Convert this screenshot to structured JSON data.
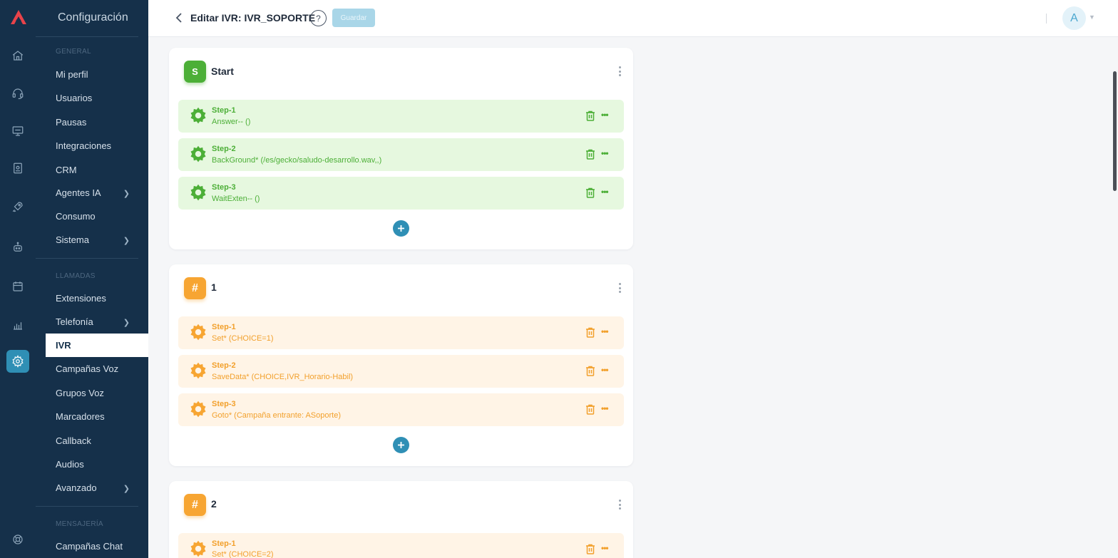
{
  "rail": {
    "icons": [
      "logo-icon",
      "home-icon",
      "headset-icon",
      "monitor-icon",
      "badge-icon",
      "rocket-icon",
      "bot-icon",
      "calendar-icon",
      "chart-icon",
      "settings-icon",
      "support-icon"
    ]
  },
  "sidebar": {
    "title": "Configuración",
    "sections": {
      "general": "GENERAL",
      "llamadas": "LLAMADAS",
      "mensajeria": "MENSAJERÍA"
    },
    "items": [
      {
        "label": "Mi perfil"
      },
      {
        "label": "Usuarios"
      },
      {
        "label": "Pausas"
      },
      {
        "label": "Integraciones"
      },
      {
        "label": "CRM"
      },
      {
        "label": "Agentes IA"
      },
      {
        "label": "Consumo"
      },
      {
        "label": "Sistema"
      },
      {
        "label": "Extensiones"
      },
      {
        "label": "Telefonía"
      },
      {
        "label": "IVR"
      },
      {
        "label": "Campañas Voz"
      },
      {
        "label": "Grupos Voz"
      },
      {
        "label": "Marcadores"
      },
      {
        "label": "Callback"
      },
      {
        "label": "Audios"
      },
      {
        "label": "Avanzado"
      },
      {
        "label": "Campañas Chat"
      }
    ]
  },
  "header": {
    "title": "Editar IVR: IVR_SOPORTE",
    "help": "?",
    "save_label": "Guardar",
    "avatar_initial": "A"
  },
  "colors": {
    "sidebar_bg": "#15304a",
    "accent": "#2f8fb5",
    "green": "#4caf37",
    "orange": "#f7a532"
  },
  "cards": [
    {
      "badge": "S",
      "title": "Start",
      "steps": [
        {
          "name": "Step-1",
          "desc": "Answer-- ()"
        },
        {
          "name": "Step-2",
          "desc": "BackGround* (/es/gecko/saludo-desarrollo.wav,,)"
        },
        {
          "name": "Step-3",
          "desc": "WaitExten-- ()"
        }
      ]
    },
    {
      "badge": "#",
      "title": "1",
      "steps": [
        {
          "name": "Step-1",
          "desc": "Set* (CHOICE=1)"
        },
        {
          "name": "Step-2",
          "desc": "SaveData* (CHOICE,IVR_Horario-Habil)"
        },
        {
          "name": "Step-3",
          "desc": "Goto* (Campaña entrante: ASoporte)"
        }
      ]
    },
    {
      "badge": "#",
      "title": "2",
      "steps": [
        {
          "name": "Step-1",
          "desc": "Set* (CHOICE=2)"
        }
      ]
    }
  ]
}
